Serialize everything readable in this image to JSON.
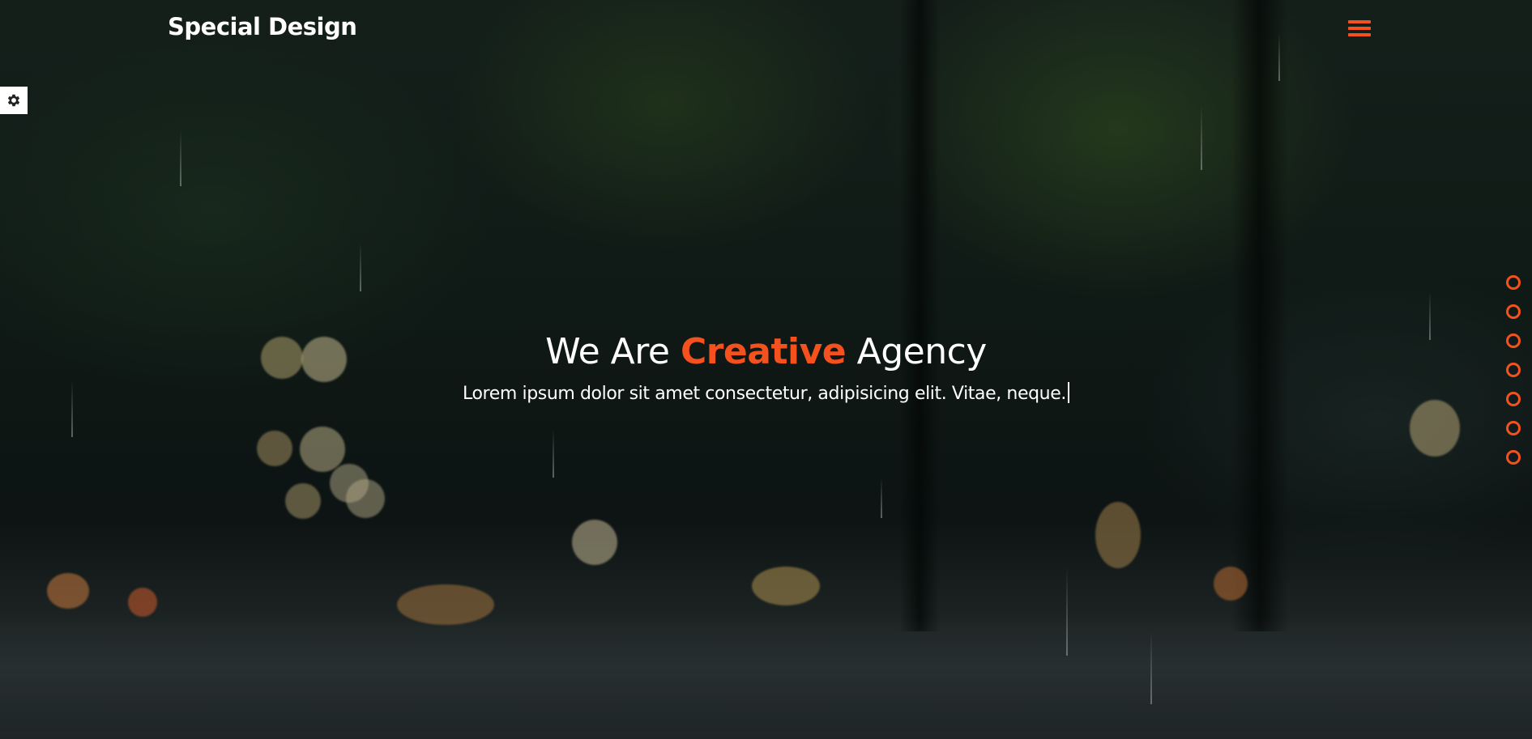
{
  "header": {
    "brand": "Special Design",
    "menu_icon": "hamburger-menu-icon"
  },
  "settings": {
    "icon": "gear-icon"
  },
  "hero": {
    "title_before": "We Are",
    "title_accent": "Creative",
    "title_after": "Agency",
    "subtitle": "Lorem ipsum dolor sit amet consectetur, adipisicing elit. Vitae, neque."
  },
  "nav_bullets": {
    "count": 7,
    "icon": "circle-outline-icon"
  },
  "colors": {
    "accent": "#f4511e",
    "text": "#ffffff",
    "settings_bg": "#ffffff"
  }
}
